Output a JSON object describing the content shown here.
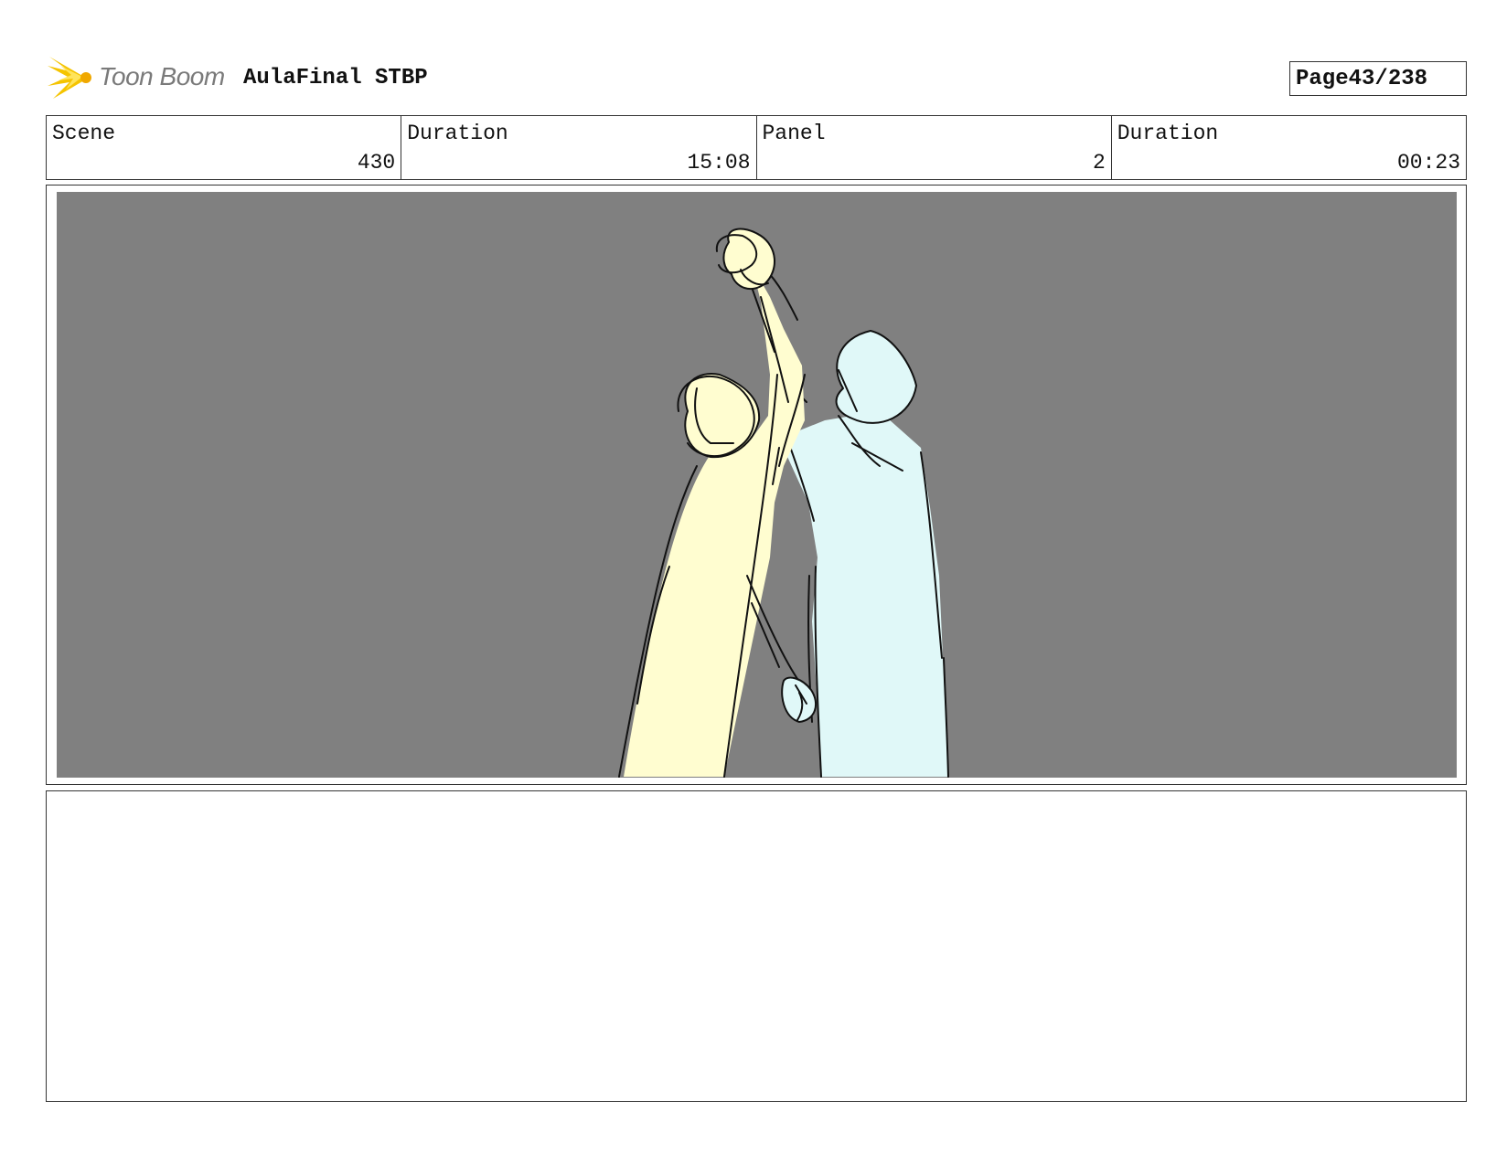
{
  "header": {
    "logo_text": "Toon Boom",
    "project_title": "AulaFinal STBP",
    "page_label": "Page",
    "page_number": "43/238"
  },
  "info": {
    "scene_label": "Scene",
    "scene_value": "430",
    "scene_duration_label": "Duration",
    "scene_duration_value": "15:08",
    "panel_label": "Panel",
    "panel_value": "2",
    "panel_duration_label": "Duration",
    "panel_duration_value": "00:23"
  },
  "colors": {
    "panel_background": "#808080",
    "figure_left_fill": "#fffdd0",
    "figure_right_fill": "#e0f8f8",
    "logo_burst": "#f5c400"
  },
  "notes": {
    "text": ""
  }
}
